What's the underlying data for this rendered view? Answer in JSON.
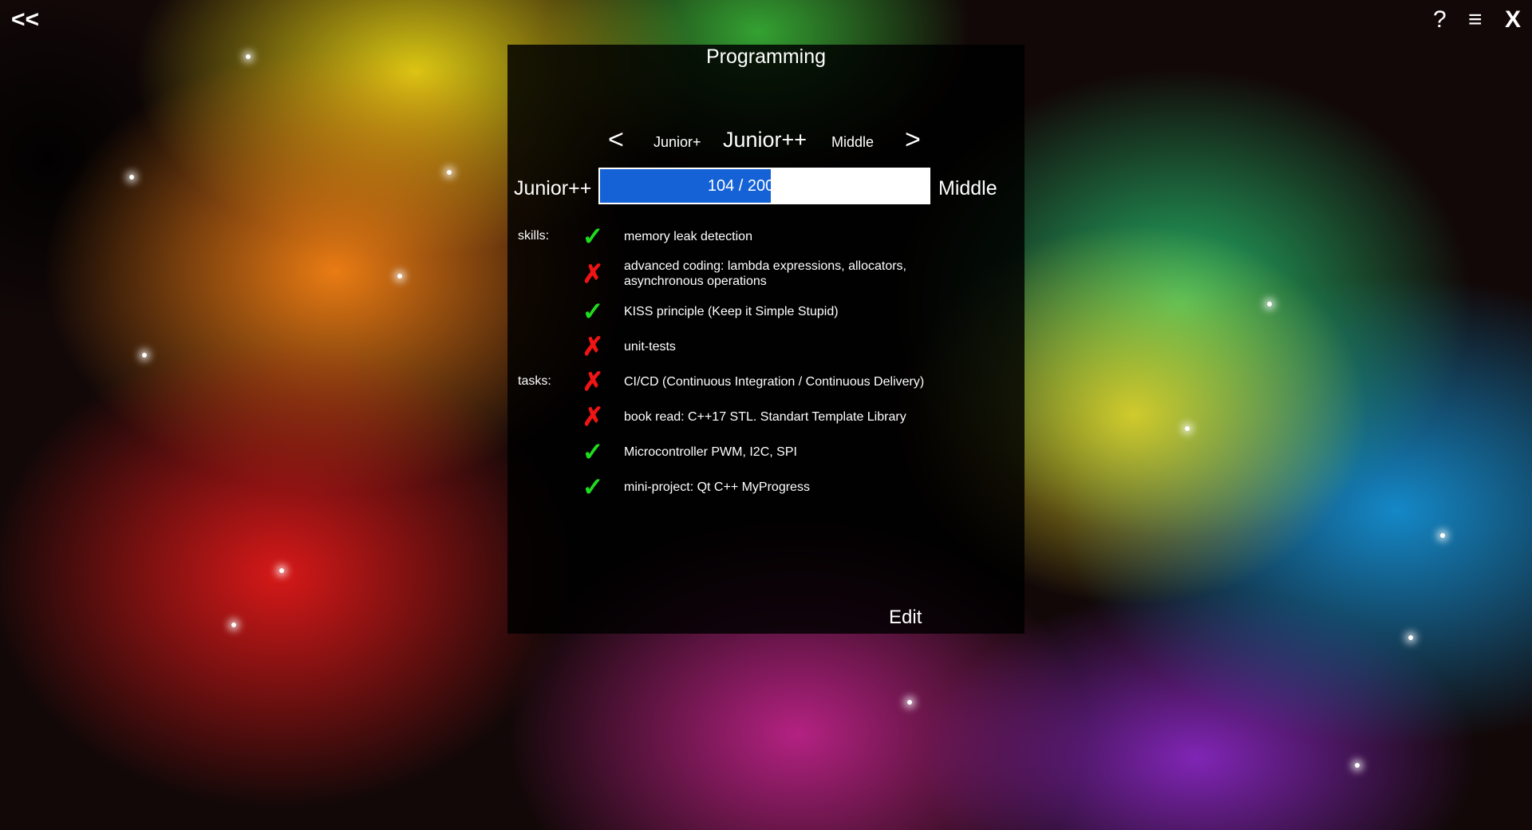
{
  "topbar": {
    "back_label": "<<",
    "help_label": "?",
    "menu_label": "≡",
    "close_label": "X"
  },
  "panel": {
    "title": "Programming",
    "nav": {
      "prev_arrow": "<",
      "next_arrow": ">",
      "prev_level": "Junior+",
      "current_level": "Junior++",
      "next_level": "Middle"
    },
    "progress": {
      "from_level": "Junior++",
      "to_level": "Middle",
      "text": "104 / 200 (52%)",
      "current": 104,
      "total": 200,
      "fraction": 0.52
    },
    "items": [
      {
        "category": "skills:",
        "done": true,
        "text": "memory leak detection"
      },
      {
        "category": "",
        "done": false,
        "text": "advanced coding: lambda expressions, allocators, asynchronous operations"
      },
      {
        "category": "",
        "done": true,
        "text": "KISS principle (Keep it Simple Stupid)"
      },
      {
        "category": "",
        "done": false,
        "text": "unit-tests"
      },
      {
        "category": "tasks:",
        "done": false,
        "text": "CI/CD (Continuous Integration / Continuous Delivery)"
      },
      {
        "category": "",
        "done": false,
        "text": "book read: C++17 STL. Standart Template Library"
      },
      {
        "category": "",
        "done": true,
        "text": "Microcontroller PWM, I2C, SPI"
      },
      {
        "category": "",
        "done": true,
        "text": "mini-project: Qt C++ MyProgress"
      }
    ],
    "marks": {
      "done": "✓",
      "not_done": "✗"
    },
    "edit_label": "Edit"
  },
  "colors": {
    "progress_fill": "#1462d6",
    "check": "#1fdc1f",
    "cross": "#f01414"
  }
}
